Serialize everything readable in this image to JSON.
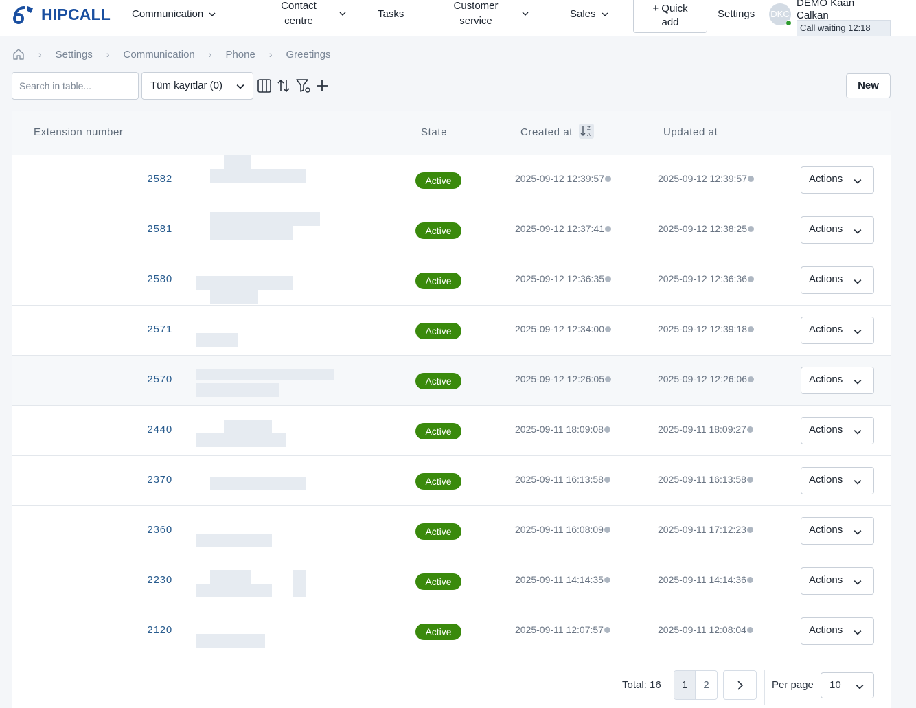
{
  "brand": {
    "name": "HIPCALL",
    "color": "#1a4fa0"
  },
  "nav": {
    "communication": "Communication",
    "contact_centre_1": "Contact",
    "contact_centre_2": "centre",
    "tasks": "Tasks",
    "customer_service_1": "Customer",
    "customer_service_2": "service",
    "sales": "Sales",
    "quick_add_1": "+ Quick",
    "quick_add_2": "add",
    "settings": "Settings"
  },
  "user": {
    "initials": "DKC",
    "name_1": "DEMO Kaan",
    "name_2": "Calkan",
    "status": "Call waiting 12:18"
  },
  "breadcrumb": [
    "Settings",
    "Communication",
    "Phone",
    "Greetings"
  ],
  "toolbar": {
    "search_placeholder": "Search in table...",
    "filter_value": "Tüm kayıtlar (0)",
    "new_label": "New"
  },
  "table": {
    "headers": {
      "extension": "Extension number",
      "state": "State",
      "created": "Created at",
      "updated": "Updated at"
    },
    "actions_label": "Actions",
    "status_color": "#3a8a0c",
    "rows": [
      {
        "ext": "2582",
        "state": "Active",
        "created": "2025-09-12 12:39:57",
        "updated": "2025-09-12 12:39:57"
      },
      {
        "ext": "2581",
        "state": "Active",
        "created": "2025-09-12 12:37:41",
        "updated": "2025-09-12 12:38:25"
      },
      {
        "ext": "2580",
        "state": "Active",
        "created": "2025-09-12 12:36:35",
        "updated": "2025-09-12 12:36:36"
      },
      {
        "ext": "2571",
        "state": "Active",
        "created": "2025-09-12 12:34:00",
        "updated": "2025-09-12 12:39:18"
      },
      {
        "ext": "2570",
        "state": "Active",
        "created": "2025-09-12 12:26:05",
        "updated": "2025-09-12 12:26:06"
      },
      {
        "ext": "2440",
        "state": "Active",
        "created": "2025-09-11 18:09:08",
        "updated": "2025-09-11 18:09:27"
      },
      {
        "ext": "2370",
        "state": "Active",
        "created": "2025-09-11 16:13:58",
        "updated": "2025-09-11 16:13:58"
      },
      {
        "ext": "2360",
        "state": "Active",
        "created": "2025-09-11 16:08:09",
        "updated": "2025-09-11 17:12:23"
      },
      {
        "ext": "2230",
        "state": "Active",
        "created": "2025-09-11 14:14:35",
        "updated": "2025-09-11 14:14:36"
      },
      {
        "ext": "2120",
        "state": "Active",
        "created": "2025-09-11 12:07:57",
        "updated": "2025-09-11 12:08:04"
      }
    ]
  },
  "pagination": {
    "total": "Total: 16",
    "pages": [
      "1",
      "2"
    ],
    "current": "1",
    "per_page_label": "Per page",
    "per_page_value": "10"
  }
}
